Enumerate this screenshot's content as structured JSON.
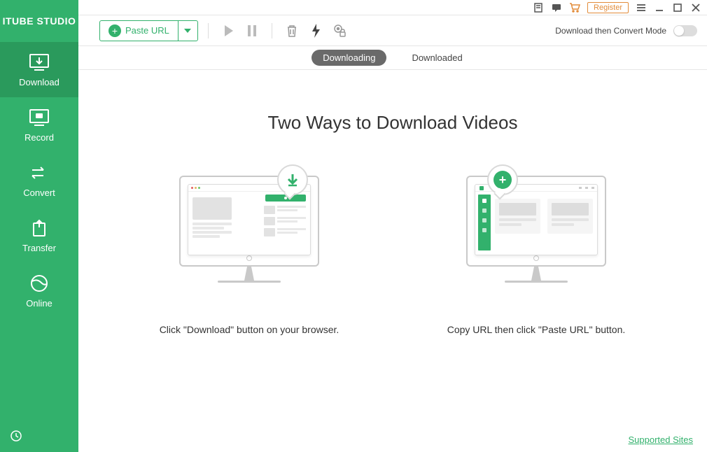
{
  "app": {
    "name": "ITUBE STUDIO"
  },
  "sidebar": {
    "items": [
      {
        "label": "Download"
      },
      {
        "label": "Record"
      },
      {
        "label": "Convert"
      },
      {
        "label": "Transfer"
      },
      {
        "label": "Online"
      }
    ]
  },
  "topbar": {
    "register": "Register"
  },
  "toolbar": {
    "paste_url": "Paste URL",
    "convert_mode_label": "Download then Convert Mode"
  },
  "tabs": {
    "downloading": "Downloading",
    "downloaded": "Downloaded"
  },
  "content": {
    "title": "Two Ways to Download Videos",
    "method1_caption": "Click \"Download\" button on your browser.",
    "method2_caption": "Copy URL then click \"Paste URL\" button."
  },
  "footer": {
    "supported_sites": "Supported Sites"
  }
}
